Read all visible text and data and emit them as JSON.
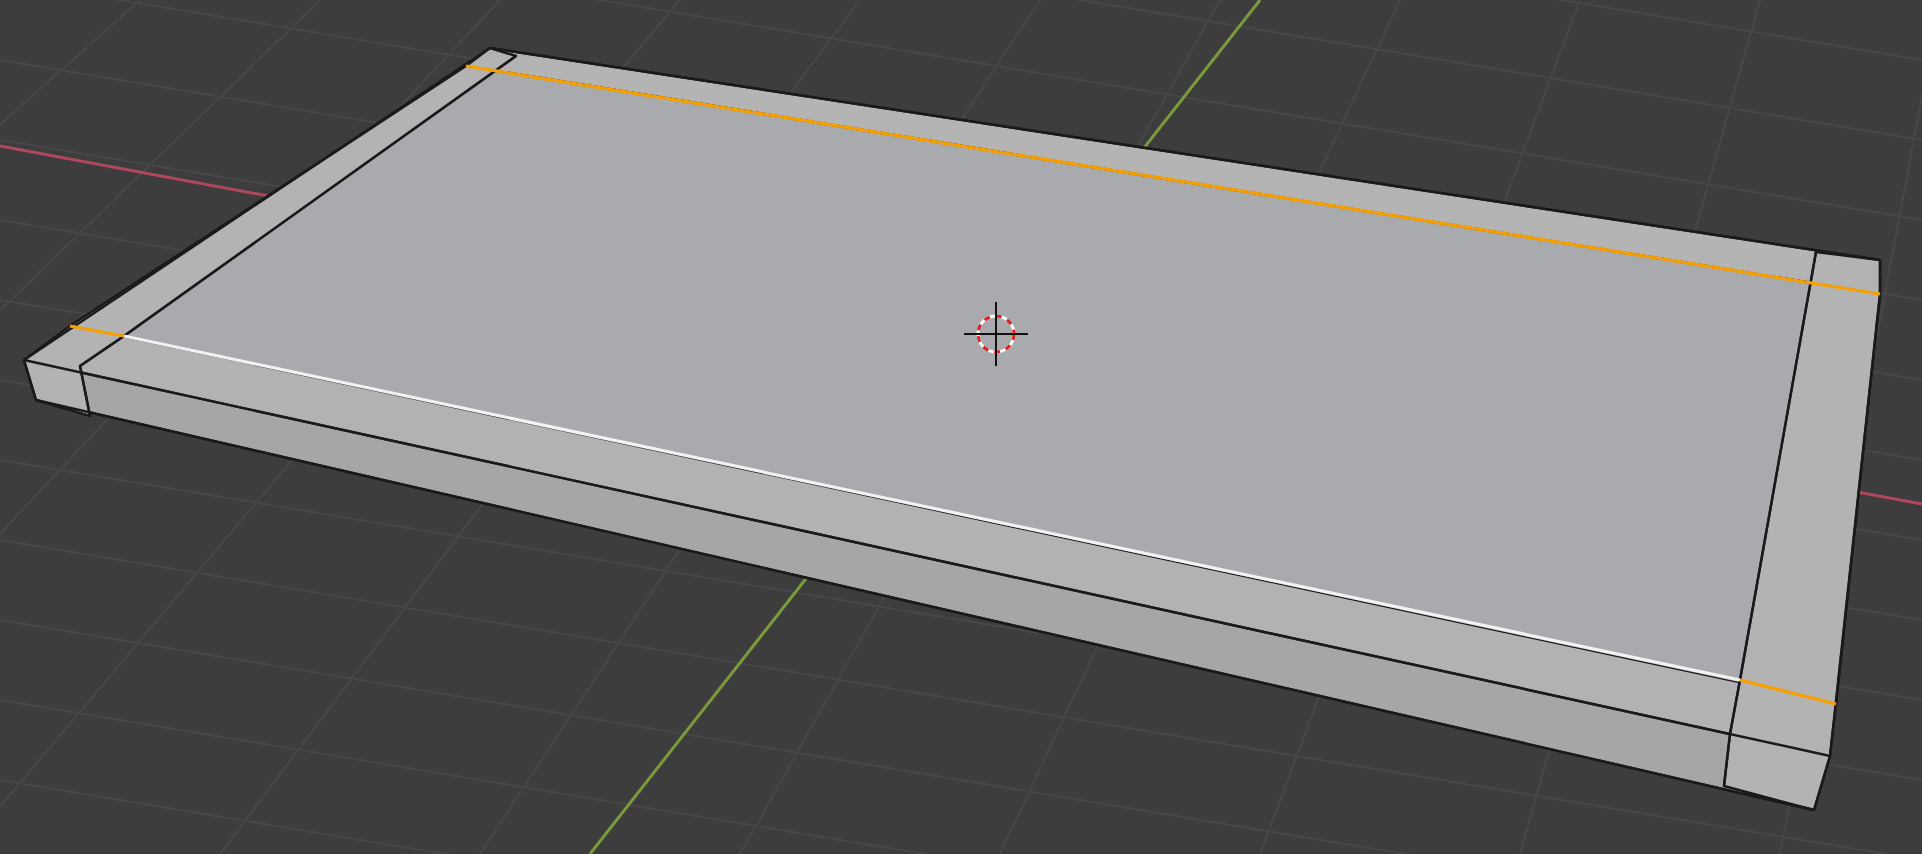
{
  "viewport": {
    "edges": [
      {
        "kind": "back",
        "selected": true,
        "active": false
      },
      {
        "kind": "left",
        "selected": true,
        "active": false
      },
      {
        "kind": "front",
        "selected": true,
        "active": true
      },
      {
        "kind": "right",
        "selected": true,
        "active": false
      }
    ]
  }
}
